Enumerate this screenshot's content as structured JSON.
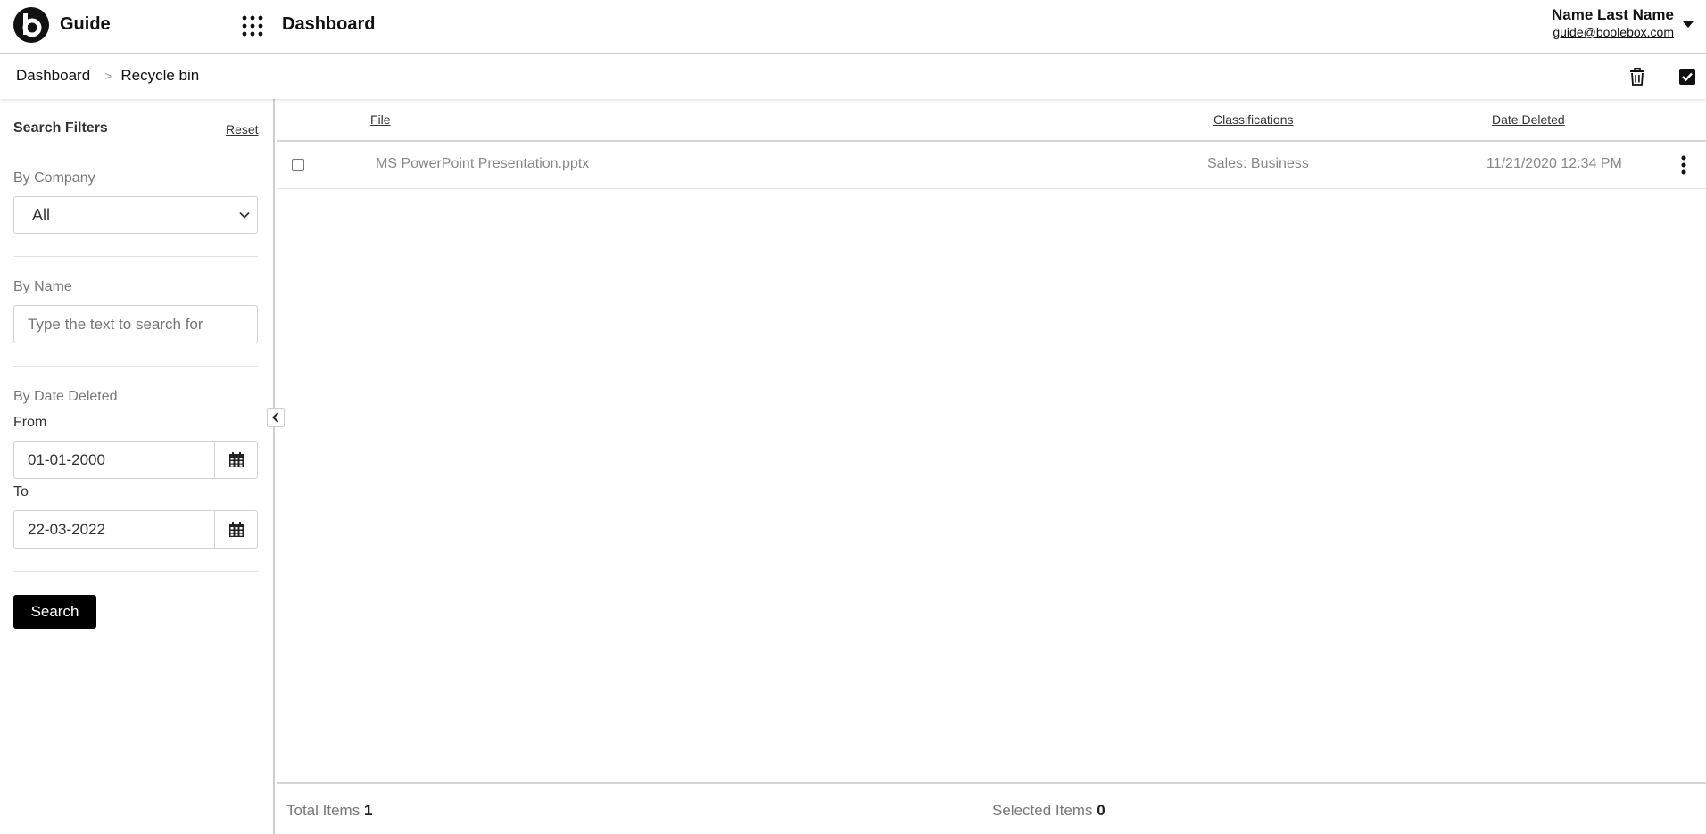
{
  "header": {
    "app_name": "Guide",
    "page_title": "Dashboard",
    "user_name": "Name Last Name",
    "user_email": "guide@boolebox.com"
  },
  "breadcrumb": {
    "items": [
      "Dashboard",
      "Recycle bin"
    ],
    "separator": ">"
  },
  "sidebar": {
    "title": "Search Filters",
    "reset_label": "Reset",
    "company_label": "By Company",
    "company_value": "All",
    "name_label": "By Name",
    "name_placeholder": "Type the text to search for",
    "date_label": "By Date Deleted",
    "from_label": "From",
    "from_value": "01-01-2000",
    "to_label": "To",
    "to_value": "22-03-2022",
    "search_label": "Search"
  },
  "table": {
    "columns": [
      "File",
      "Classifications",
      "Date Deleted"
    ],
    "rows": [
      {
        "file": "MS PowerPoint Presentation.pptx",
        "classification": "Sales: Business",
        "date_deleted": "11/21/2020 12:34 PM"
      }
    ]
  },
  "footer": {
    "total_label": "Total Items",
    "total_value": "1",
    "selected_label": "Selected Items",
    "selected_value": "0"
  },
  "icons": {
    "logo": "boolebox-logo-icon",
    "apps": "apps-grid-icon",
    "user_caret": "caret-down-icon",
    "trash": "trash-icon",
    "select_all": "checkbox-checked-icon",
    "calendar": "calendar-icon",
    "collapse": "chevron-left-icon",
    "row_menu": "more-vertical-icon"
  }
}
